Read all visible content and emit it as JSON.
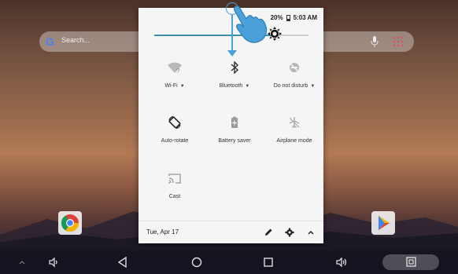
{
  "status": {
    "battery": "20%",
    "time": "5:03 AM"
  },
  "search": {
    "placeholder": "Search..."
  },
  "brightness": {
    "level": 0.78
  },
  "tiles": [
    {
      "id": "wifi",
      "label": "Wi-Fi",
      "icon": "wifi-question-icon",
      "has_dropdown": true
    },
    {
      "id": "bluetooth",
      "label": "Bluetooth",
      "icon": "bluetooth-icon",
      "has_dropdown": true
    },
    {
      "id": "dnd",
      "label": "Do not disturb",
      "icon": "do-not-disturb-icon",
      "has_dropdown": true
    },
    {
      "id": "autorotate",
      "label": "Auto-rotate",
      "icon": "auto-rotate-icon",
      "has_dropdown": false
    },
    {
      "id": "battery-saver",
      "label": "Battery saver",
      "icon": "battery-saver-icon",
      "has_dropdown": false
    },
    {
      "id": "airplane",
      "label": "Airplane mode",
      "icon": "airplane-mode-off-icon",
      "has_dropdown": false
    },
    {
      "id": "cast",
      "label": "Cast",
      "icon": "cast-icon",
      "has_dropdown": false
    }
  ],
  "footer": {
    "date": "Tue, Apr 17"
  },
  "colors": {
    "accent": "#3c8fa8",
    "gesture": "#4aa0d8",
    "panel": "#f5f5f5"
  }
}
